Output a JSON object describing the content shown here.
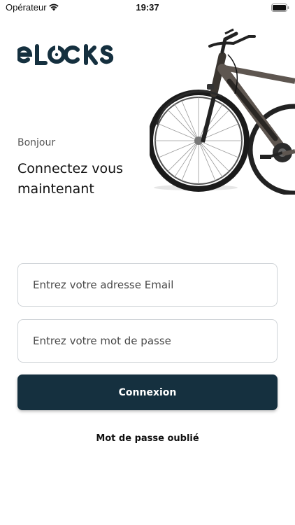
{
  "status_bar": {
    "carrier": "Opérateur",
    "time": "19:37",
    "icons": [
      "wifi-icon",
      "battery-icon"
    ]
  },
  "brand": {
    "logo_text": "eLOCKS",
    "color": "#15303f"
  },
  "hero": {
    "image": "electric-bike"
  },
  "greeting": "Bonjour",
  "headline": "Connectez vous maintenant",
  "form": {
    "email_placeholder": "Entrez votre adresse Email",
    "email_value": "",
    "password_placeholder": "Entrez votre mot de passe",
    "password_value": "",
    "login_label": "Connexion",
    "login_button_color": "#15303f"
  },
  "forgot_password_label": "Mot de passe oublié"
}
